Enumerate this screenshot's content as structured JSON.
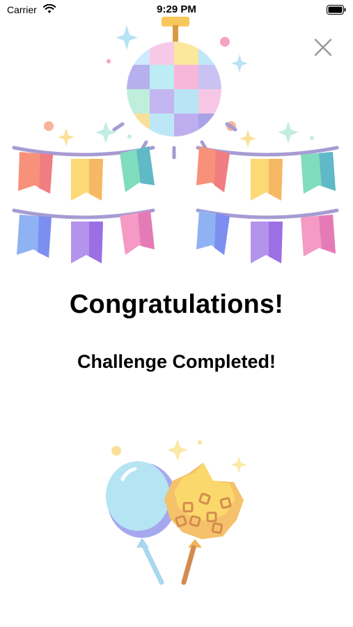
{
  "status_bar": {
    "carrier": "Carrier",
    "time": "9:29 PM"
  },
  "dialog": {
    "title": "Congratulations!",
    "subtitle": "Challenge Completed!"
  },
  "icons": {
    "close": "close-icon",
    "top_illustration": "disco-ball-bunting-illustration",
    "bottom_illustration": "balloons-illustration"
  },
  "colors": {
    "text": "#000000",
    "close": "#9a9a9a",
    "background": "#ffffff"
  }
}
